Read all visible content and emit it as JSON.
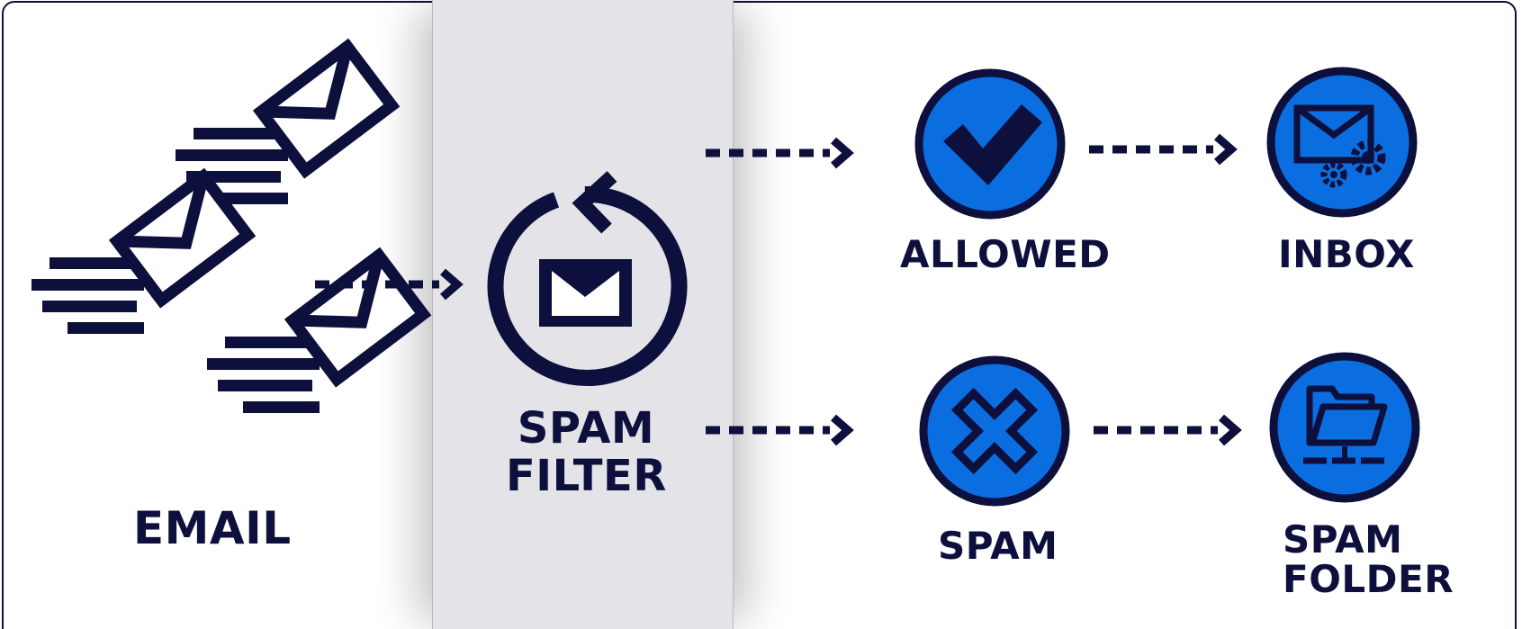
{
  "labels": {
    "email": "EMAIL",
    "filter": "SPAM\nFILTER",
    "allowed": "ALLOWED",
    "inbox": "INBOX",
    "spam": "SPAM",
    "spam_folder": "SPAM\nFOLDER"
  },
  "colors": {
    "navy": "#0d0f3c",
    "blue": "#0b6ee0",
    "filter_band": "#e3e3e8",
    "background": "#ffffff"
  },
  "icons": [
    "envelope-icon",
    "refresh-mail-icon",
    "check-icon",
    "inbox-settings-icon",
    "x-icon",
    "folder-network-icon"
  ]
}
